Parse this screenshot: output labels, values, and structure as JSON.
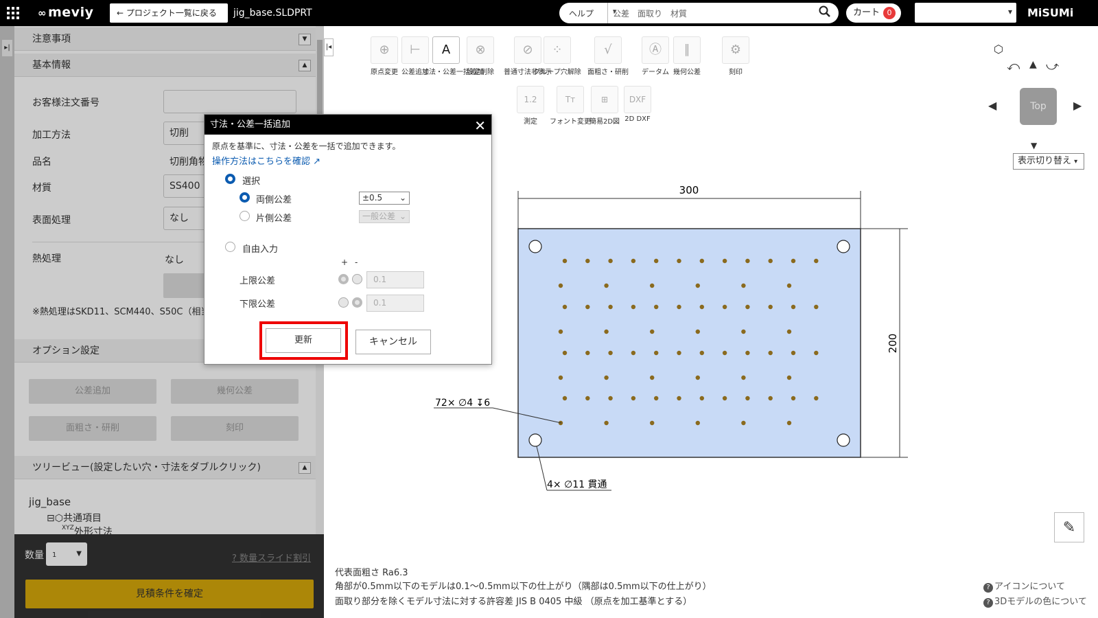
{
  "topbar": {
    "logo": "meviy",
    "back_label": "← プロジェクト一覧に戻る",
    "filename": "jig_base.SLDPRT",
    "search_category": "ヘルプ",
    "search_placeholder": "公差　面取り　材質",
    "cart_label": "カート",
    "cart_count": "0",
    "brand": "MiSUMi"
  },
  "left_panel": {
    "caution_header": "注意事項",
    "basic_header": "基本情報",
    "order_no_label": "お客様注文番号",
    "method_label": "加工方法",
    "method_value": "切削",
    "name_label": "品名",
    "name_value": "切削角物",
    "material_label": "材質",
    "material_value": "SS400",
    "surface_label": "表面処理",
    "surface_value": "なし",
    "heat_label": "熱処理",
    "heat_value": "なし",
    "heat_note": "※熱処理はSKD11、SCM440、S50C（相当品）で利用可能です。",
    "option_header": "オプション設定",
    "opt_tolerance": "公差追加",
    "opt_geometric": "幾何公差",
    "opt_roughness": "面粗さ・研削",
    "opt_engrave": "刻印",
    "tree_header": "ツリービュー(設定したい穴・寸法をダブルクリック)",
    "tree_root": "jig_base",
    "tree_common": "共通項目",
    "tree_outer": "外形寸法",
    "qty_label": "数量",
    "qty_value": "1",
    "slide_discount": "数量スライド割引",
    "confirm_label": "見積条件を確定"
  },
  "toolbar": [
    {
      "label": "原点変更",
      "icon": "origin-icon"
    },
    {
      "label": "公差追加",
      "icon": "tolerance-add-icon"
    },
    {
      "label": "寸法・公差一括追加",
      "icon": "bulk-dimension-icon"
    },
    {
      "label": "設定削除",
      "icon": "delete-setting-icon"
    },
    {
      "label": "普通寸法非表示",
      "icon": "hide-dimension-icon"
    },
    {
      "label": "グループ穴解除",
      "icon": "group-hole-icon"
    },
    {
      "label": "面粗さ・研削",
      "icon": "roughness-icon"
    },
    {
      "label": "データム",
      "icon": "datum-icon"
    },
    {
      "label": "幾何公差",
      "icon": "geometric-icon"
    },
    {
      "label": "刻印",
      "icon": "engrave-icon"
    },
    {
      "label": "測定",
      "icon": "measure-icon"
    },
    {
      "label": "フォント変更",
      "icon": "font-icon"
    },
    {
      "label": "簡易2D図",
      "icon": "simple-2d-icon"
    },
    {
      "label": "2D DXF",
      "icon": "dxf-icon"
    }
  ],
  "view": {
    "cube_label": "Top",
    "switch_label": "表示切り替え"
  },
  "dialog": {
    "title": "寸法・公差一括追加",
    "description": "原点を基準に、寸法・公差を一括で追加できます。",
    "help_link": "操作方法はこちらを確認",
    "select_label": "選択",
    "both_label": "両側公差",
    "both_value": "±0.5",
    "one_label": "片側公差",
    "one_value": "一般公差",
    "free_label": "自由入力",
    "plus": "+",
    "minus": "-",
    "upper_label": "上限公差",
    "upper_value": "0.1",
    "lower_label": "下限公差",
    "lower_value": "0.1",
    "update_label": "更新",
    "cancel_label": "キャンセル"
  },
  "drawing": {
    "width_dim": "300",
    "height_dim": "200",
    "small_hole_note": "72× ∅4 ↧6",
    "big_hole_note": "4× ∅11 貫通",
    "plate_color": "#c8daf6"
  },
  "footer": {
    "line1": "代表面粗さ Ra6.3",
    "line2": "角部が0.5mm以下のモデルは0.1～0.5mm以下の仕上がり（隅部は0.5mm以下の仕上がり）",
    "line3": "面取り部分を除くモデル寸法に対する許容差 JIS B 0405 中級 （原点を加工基準とする）",
    "help_icons": "アイコンについて",
    "help_colors": "3Dモデルの色について"
  }
}
